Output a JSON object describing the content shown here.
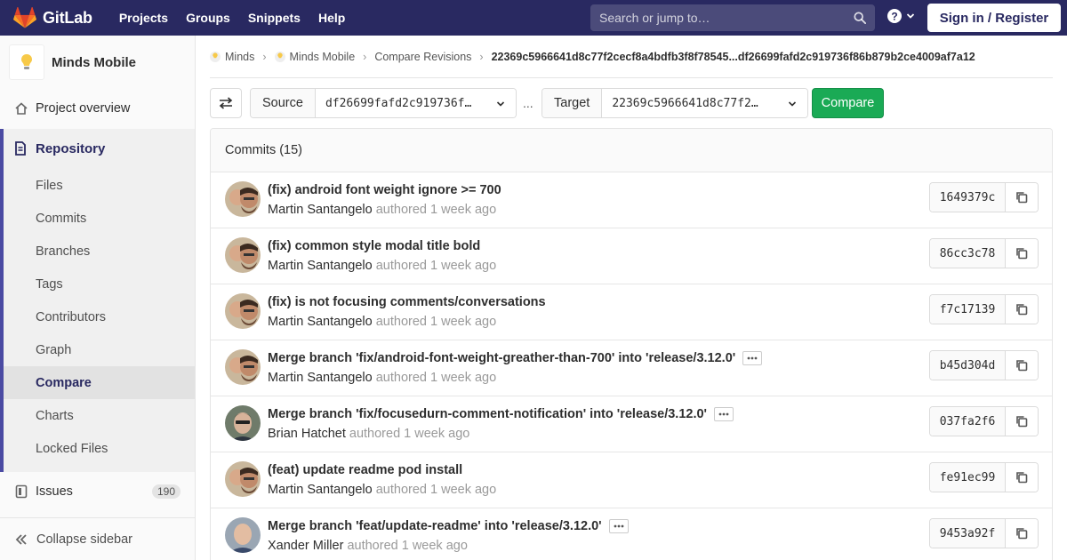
{
  "navbar": {
    "brand": "GitLab",
    "links": [
      "Projects",
      "Groups",
      "Snippets",
      "Help"
    ],
    "search_placeholder": "Search or jump to…",
    "signin": "Sign in / Register",
    "colors": {
      "background": "#292961",
      "accent": "#fc6d26"
    }
  },
  "sidebar": {
    "project_name": "Minds Mobile",
    "overview": "Project overview",
    "repository": "Repository",
    "repo_items": [
      "Files",
      "Commits",
      "Branches",
      "Tags",
      "Contributors",
      "Graph",
      "Compare",
      "Charts",
      "Locked Files"
    ],
    "active_item": "Compare",
    "issues": "Issues",
    "issues_count": "190",
    "collapse": "Collapse sidebar"
  },
  "breadcrumbs": {
    "items": [
      "Minds",
      "Minds Mobile",
      "Compare Revisions"
    ],
    "current": "22369c5966641d8c77f2cecf8a4bdfb3f8f78545...df26699fafd2c919736f86b879b2ce4009af7a12"
  },
  "compare": {
    "source_label": "Source",
    "source_value": "df26699fafd2c919736f…",
    "separator": "...",
    "target_label": "Target",
    "target_value": "22369c5966641d8c77f2…",
    "button": "Compare"
  },
  "commits": {
    "header": "Commits (15)",
    "authored_text": "authored",
    "rows": [
      {
        "title": "(fix) android font weight ignore >= 700",
        "author": "Martin Santangelo",
        "time": "1 week ago",
        "sha": "1649379c",
        "has_more": false,
        "avatar": "martin"
      },
      {
        "title": "(fix) common style modal title bold",
        "author": "Martin Santangelo",
        "time": "1 week ago",
        "sha": "86cc3c78",
        "has_more": false,
        "avatar": "martin"
      },
      {
        "title": "(fix) is not focusing comments/conversations",
        "author": "Martin Santangelo",
        "time": "1 week ago",
        "sha": "f7c17139",
        "has_more": false,
        "avatar": "martin"
      },
      {
        "title": "Merge branch 'fix/android-font-weight-greather-than-700' into 'release/3.12.0'",
        "author": "Martin Santangelo",
        "time": "1 week ago",
        "sha": "b45d304d",
        "has_more": true,
        "avatar": "martin"
      },
      {
        "title": "Merge branch 'fix/focusedurn-comment-notification' into 'release/3.12.0'",
        "author": "Brian Hatchet",
        "time": "1 week ago",
        "sha": "037fa2f6",
        "has_more": true,
        "avatar": "brian"
      },
      {
        "title": "(feat) update readme pod install",
        "author": "Martin Santangelo",
        "time": "1 week ago",
        "sha": "fe91ec99",
        "has_more": false,
        "avatar": "martin"
      },
      {
        "title": "Merge branch 'feat/update-readme' into 'release/3.12.0'",
        "author": "Xander Miller",
        "time": "1 week ago",
        "sha": "9453a92f",
        "has_more": true,
        "avatar": "xander"
      }
    ]
  }
}
